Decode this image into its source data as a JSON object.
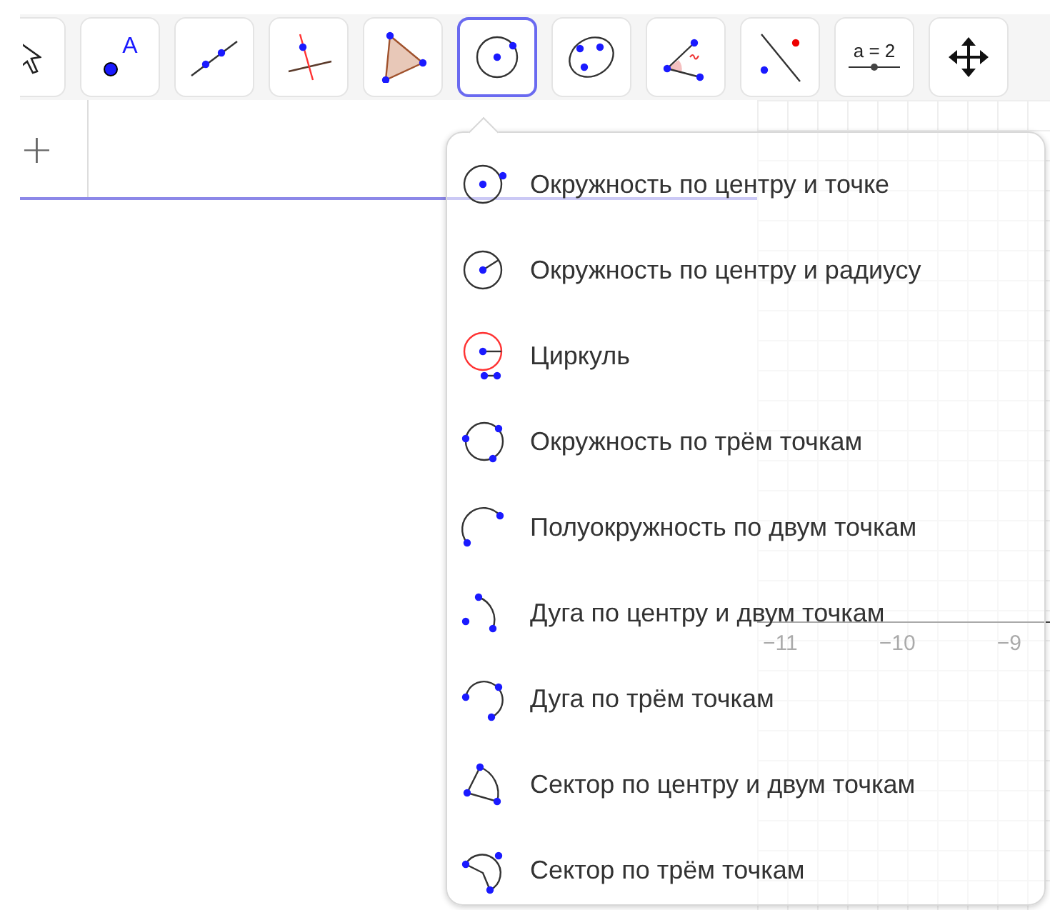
{
  "toolbar": {
    "tools": [
      {
        "kind": "move",
        "selected": false
      },
      {
        "kind": "point",
        "label": "A",
        "selected": false
      },
      {
        "kind": "line",
        "selected": false
      },
      {
        "kind": "perpendicular",
        "selected": false
      },
      {
        "kind": "polygon",
        "selected": false
      },
      {
        "kind": "circle",
        "selected": true
      },
      {
        "kind": "conic",
        "selected": false
      },
      {
        "kind": "angle",
        "selected": false
      },
      {
        "kind": "reflect",
        "selected": false
      },
      {
        "kind": "slider",
        "label": "a = 2",
        "selected": false
      },
      {
        "kind": "move-view",
        "selected": false
      }
    ]
  },
  "algebra": {
    "add_button": "+"
  },
  "graphics": {
    "axis_labels": [
      "−11",
      "−10",
      "−9"
    ]
  },
  "tool_menu": {
    "items": [
      {
        "kind": "circle-center-point",
        "label": "Окружность по центру и точке"
      },
      {
        "kind": "circle-center-radius",
        "label": "Окружность по центру и радиусу"
      },
      {
        "kind": "compass",
        "label": "Циркуль"
      },
      {
        "kind": "circle-three-points",
        "label": "Окружность по трём точкам"
      },
      {
        "kind": "semicircle",
        "label": "Полуокружность по двум точкам"
      },
      {
        "kind": "arc-center",
        "label": "Дуга по центру и двум точкам"
      },
      {
        "kind": "arc-three-points",
        "label": "Дуга по трём точкам"
      },
      {
        "kind": "sector-center",
        "label": "Сектор по центру и двум точкам"
      },
      {
        "kind": "sector-three-points",
        "label": "Сектор по трём точкам"
      }
    ]
  }
}
